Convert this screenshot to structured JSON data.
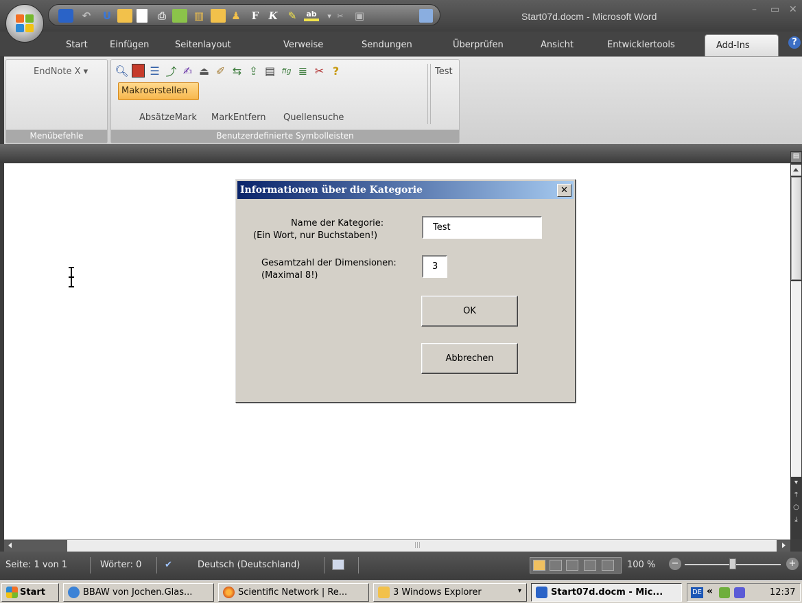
{
  "window": {
    "title": "Start07d.docm - Microsoft Word",
    "minimize": "–",
    "maximize": "▭",
    "close": "✕"
  },
  "quick_access": {
    "bold_label": "F",
    "italic_label": "K"
  },
  "ribbon": {
    "tabs": [
      "Start",
      "Einfügen",
      "Seitenlayout",
      "Verweise",
      "Sendungen",
      "Überprüfen",
      "Ansicht",
      "Entwicklertools",
      "Add-Ins"
    ],
    "active_tab": "Add-Ins",
    "help": "?",
    "menu_group": {
      "endnote_label": "EndNote X ▾",
      "group_label": "Menübefehle"
    },
    "toolbar_group": {
      "makro_button": "Makroerstellen",
      "links": [
        "AbsätzeMark",
        "MarkEntfern",
        "Quellensuche"
      ],
      "test_button": "Test",
      "group_label": "Benutzerdefinierte Symbolleisten"
    }
  },
  "dialog": {
    "title": "Informationen über die Kategorie",
    "close_glyph": "✕",
    "name_label_line1": "Name der Kategorie:",
    "name_label_line2": "(Ein Wort, nur Buchstaben!)",
    "name_value": "Test",
    "dim_label_line1": "Gesamtzahl der Dimensionen:",
    "dim_label_line2": "(Maximal 8!)",
    "dim_value": "3",
    "ok_button": "OK",
    "cancel_button": "Abbrechen"
  },
  "statusbar": {
    "page": "Seite: 1 von 1",
    "words": "Wörter: 0",
    "language": "Deutsch (Deutschland)",
    "zoom": "100 %",
    "zoom_level": 0.5
  },
  "taskbar": {
    "start": "Start",
    "buttons": [
      {
        "label": "BBAW von Jochen.Glas...",
        "icon": "ie-icon"
      },
      {
        "label": "Scientific Network | Re...",
        "icon": "firefox-icon"
      },
      {
        "label": "3 Windows Explorer",
        "icon": "folder-icon"
      },
      {
        "label": "Start07d.docm - Mic...",
        "icon": "word-icon"
      }
    ],
    "language": "DE",
    "expand": "«",
    "clock": "12:37"
  },
  "colors": {
    "dialog_title_start": "#0a246a",
    "dialog_title_end": "#a6caf0",
    "makro_highlight": "#f7b74d",
    "taskbar": "#d4d0c8"
  }
}
